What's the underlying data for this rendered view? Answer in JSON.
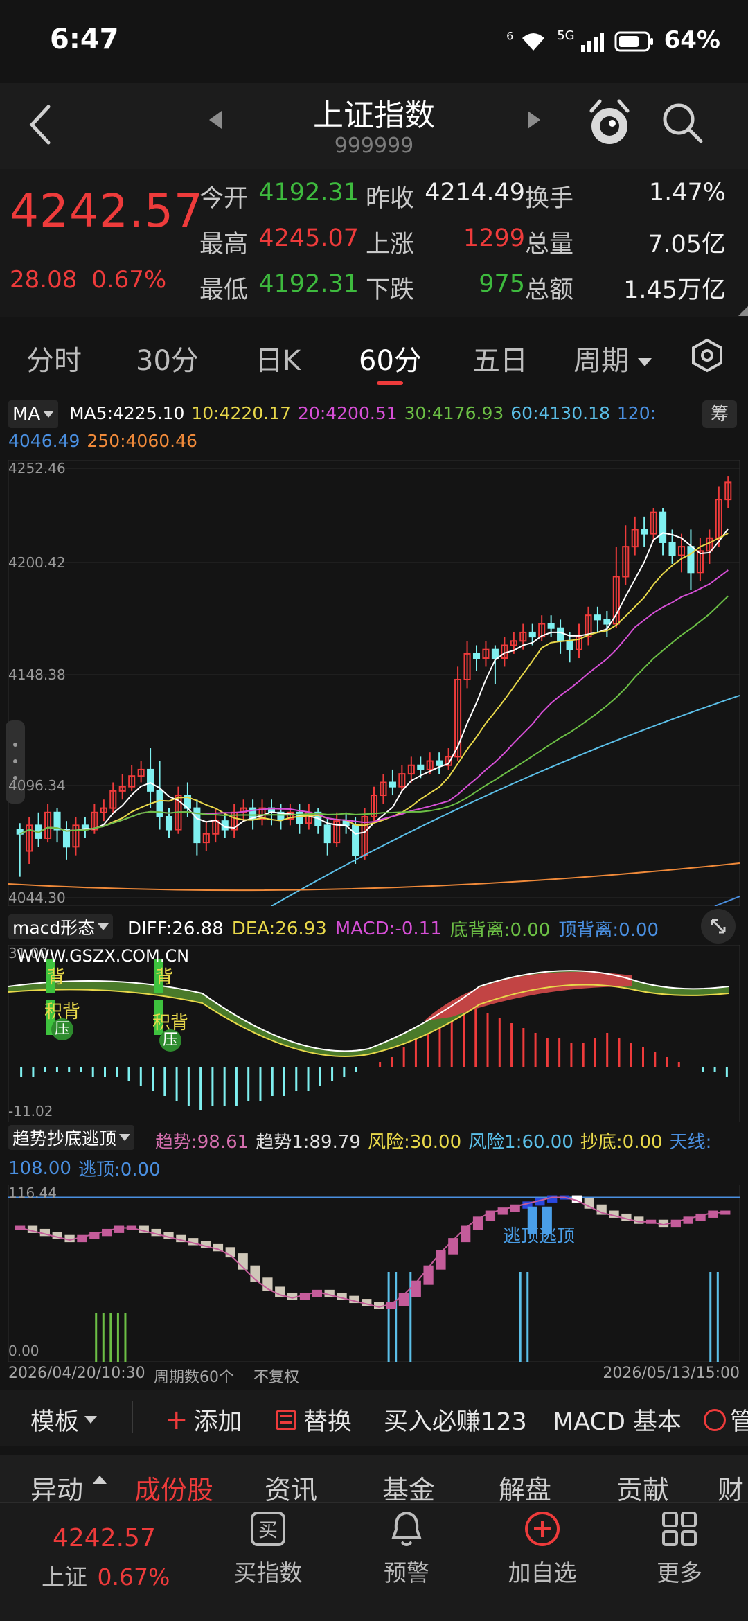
{
  "status": {
    "time": "6:47",
    "net1": "6",
    "net2": "5G",
    "battery": "64%"
  },
  "header": {
    "title": "上证指数",
    "code": "999999"
  },
  "quote": {
    "price": "4242.57",
    "change": "28.08",
    "change_pct": "0.67%",
    "cells": [
      {
        "label": "今开",
        "value": "4192.31",
        "tone": "green"
      },
      {
        "label": "昨收",
        "value": "4214.49",
        "tone": "white"
      },
      {
        "label": "换手",
        "value": "1.47%",
        "tone": "white"
      },
      {
        "label": "最高",
        "value": "4245.07",
        "tone": "red"
      },
      {
        "label": "上涨",
        "value": "1299",
        "tone": "red"
      },
      {
        "label": "总量",
        "value": "7.05亿",
        "tone": "white"
      },
      {
        "label": "最低",
        "value": "4192.31",
        "tone": "green"
      },
      {
        "label": "下跌",
        "value": "975",
        "tone": "green"
      },
      {
        "label": "总额",
        "value": "1.45万亿",
        "tone": "white"
      }
    ]
  },
  "tabs": [
    "分时",
    "30分",
    "日K",
    "60分",
    "五日",
    "周期"
  ],
  "active_tab": "60分",
  "ma": {
    "selector": "MA",
    "line1": [
      {
        "text": "MA5:4225.10",
        "color": "#ffffff"
      },
      {
        "text": "10:4220.17",
        "color": "#e8d84a"
      },
      {
        "text": "20:4200.51",
        "color": "#d64fd6"
      },
      {
        "text": "30:4176.93",
        "color": "#6cbf45"
      },
      {
        "text": "60:4130.18",
        "color": "#5bbfe8"
      },
      {
        "text": "120:",
        "color": "#4a8fe0"
      }
    ],
    "line2": [
      {
        "text": "4046.49",
        "color": "#4a8fe0"
      },
      {
        "text": "250:4060.46",
        "color": "#f08a3a"
      }
    ],
    "chip": "筹"
  },
  "price_axis": [
    "4252.46",
    "4200.42",
    "4148.38",
    "4096.34",
    "4044.30"
  ],
  "macd": {
    "selector": "macd形态",
    "fields": [
      {
        "text": "DIFF:26.88",
        "color": "#ffffff"
      },
      {
        "text": "DEA:26.93",
        "color": "#e8d84a"
      },
      {
        "text": "MACD:-0.11",
        "color": "#d64fd6"
      },
      {
        "text": "底背离:0.00",
        "color": "#6cbf45"
      },
      {
        "text": "顶背离:0.00",
        "color": "#4a8fe0"
      }
    ],
    "axis_top": "31.00",
    "axis_bottom": "-11.02",
    "watermark": "WWW.GSZX.COM.CN",
    "mark_a": "背",
    "mark_b": "积背",
    "mark_c": "压"
  },
  "trend": {
    "selector": "趋势抄底逃顶",
    "fields1": [
      {
        "text": "趋势:98.61",
        "color": "#d46fae"
      },
      {
        "text": "趋势1:89.79",
        "color": "#e0e0e0"
      },
      {
        "text": "风险:30.00",
        "color": "#e8d84a"
      },
      {
        "text": "风险1:60.00",
        "color": "#5bbfe8"
      },
      {
        "text": "抄底:0.00",
        "color": "#e8d84a"
      },
      {
        "text": "天线:",
        "color": "#4a8fe0"
      }
    ],
    "fields2": [
      {
        "text": "108.00",
        "color": "#4a8fe0"
      },
      {
        "text": "逃顶:0.00",
        "color": "#4a8fe0"
      }
    ],
    "axis_top": "116.44",
    "axis_bottom": "0.00",
    "escape_label": "逃顶逃顶"
  },
  "footer_axis": {
    "start": "2026/04/20/10:30",
    "period": "周期数60个",
    "adjust": "不复权",
    "end": "2026/05/13/15:00"
  },
  "toolbar": {
    "template": "模板",
    "add": "添加",
    "replace": "替换",
    "promo": "买入必赚123",
    "macd_basic": "MACD 基本",
    "more": "管"
  },
  "subtabs": [
    "异动",
    "成份股",
    "资讯",
    "基金",
    "解盘",
    "贡献",
    "财"
  ],
  "active_subtab": "成份股",
  "bottom": {
    "price": "4242.57",
    "name": "上证",
    "pct": "0.67%",
    "items": [
      "买指数",
      "预警",
      "加自选",
      "更多"
    ]
  },
  "candles": [
    [
      4080,
      4078,
      4083,
      4058
    ],
    [
      4070,
      4082,
      4086,
      4064
    ],
    [
      4082,
      4076,
      4088,
      4072
    ],
    [
      4076,
      4088,
      4092,
      4074
    ],
    [
      4088,
      4080,
      4090,
      4074
    ],
    [
      4080,
      4072,
      4084,
      4066
    ],
    [
      4072,
      4082,
      4086,
      4068
    ],
    [
      4082,
      4080,
      4086,
      4076
    ],
    [
      4080,
      4088,
      4092,
      4078
    ],
    [
      4088,
      4090,
      4094,
      4084
    ],
    [
      4090,
      4098,
      4102,
      4088
    ],
    [
      4098,
      4100,
      4106,
      4094
    ],
    [
      4100,
      4105,
      4110,
      4098
    ],
    [
      4105,
      4108,
      4112,
      4102
    ],
    [
      4108,
      4098,
      4118,
      4090
    ],
    [
      4098,
      4086,
      4112,
      4080
    ],
    [
      4086,
      4080,
      4090,
      4076
    ],
    [
      4080,
      4096,
      4100,
      4078
    ],
    [
      4096,
      4090,
      4102,
      4086
    ],
    [
      4090,
      4074,
      4094,
      4068
    ],
    [
      4074,
      4078,
      4084,
      4070
    ],
    [
      4078,
      4084,
      4090,
      4074
    ],
    [
      4084,
      4080,
      4088,
      4076
    ],
    [
      4080,
      4088,
      4092,
      4076
    ],
    [
      4088,
      4090,
      4094,
      4084
    ],
    [
      4090,
      4085,
      4094,
      4080
    ],
    [
      4085,
      4090,
      4094,
      4082
    ],
    [
      4090,
      4088,
      4094,
      4082
    ],
    [
      4088,
      4085,
      4092,
      4080
    ],
    [
      4085,
      4088,
      4092,
      4082
    ],
    [
      4088,
      4083,
      4092,
      4078
    ],
    [
      4083,
      4088,
      4092,
      4080
    ],
    [
      4088,
      4082,
      4090,
      4078
    ],
    [
      4082,
      4074,
      4086,
      4068
    ],
    [
      4074,
      4084,
      4088,
      4072
    ],
    [
      4084,
      4082,
      4088,
      4078
    ],
    [
      4082,
      4068,
      4086,
      4064
    ],
    [
      4068,
      4086,
      4090,
      4066
    ],
    [
      4086,
      4096,
      4100,
      4084
    ],
    [
      4096,
      4102,
      4106,
      4092
    ],
    [
      4102,
      4100,
      4108,
      4096
    ],
    [
      4100,
      4106,
      4110,
      4098
    ],
    [
      4106,
      4110,
      4114,
      4102
    ],
    [
      4110,
      4108,
      4114,
      4104
    ],
    [
      4108,
      4112,
      4116,
      4106
    ],
    [
      4112,
      4110,
      4116,
      4106
    ],
    [
      4110,
      4114,
      4118,
      4108
    ],
    [
      4114,
      4150,
      4156,
      4112
    ],
    [
      4150,
      4162,
      4168,
      4146
    ],
    [
      4162,
      4160,
      4166,
      4154
    ],
    [
      4160,
      4164,
      4168,
      4156
    ],
    [
      4164,
      4160,
      4166,
      4148
    ],
    [
      4160,
      4166,
      4170,
      4156
    ],
    [
      4166,
      4168,
      4172,
      4162
    ],
    [
      4168,
      4172,
      4176,
      4164
    ],
    [
      4172,
      4170,
      4176,
      4166
    ],
    [
      4170,
      4176,
      4180,
      4168
    ],
    [
      4176,
      4174,
      4180,
      4170
    ],
    [
      4174,
      4168,
      4178,
      4162
    ],
    [
      4168,
      4164,
      4172,
      4158
    ],
    [
      4164,
      4170,
      4176,
      4160
    ],
    [
      4170,
      4180,
      4184,
      4166
    ],
    [
      4180,
      4178,
      4184,
      4172
    ],
    [
      4178,
      4176,
      4182,
      4170
    ],
    [
      4176,
      4198,
      4212,
      4174
    ],
    [
      4198,
      4212,
      4222,
      4194
    ],
    [
      4212,
      4220,
      4226,
      4208
    ],
    [
      4220,
      4218,
      4226,
      4212
    ],
    [
      4218,
      4228,
      4230,
      4214
    ],
    [
      4228,
      4214,
      4230,
      4208
    ],
    [
      4214,
      4208,
      4220,
      4204
    ],
    [
      4208,
      4212,
      4218,
      4200
    ],
    [
      4212,
      4200,
      4220,
      4192
    ],
    [
      4200,
      4210,
      4216,
      4196
    ],
    [
      4210,
      4216,
      4220,
      4204
    ],
    [
      4216,
      4234,
      4240,
      4212
    ],
    [
      4234,
      4242,
      4245,
      4230
    ]
  ],
  "macd_hist": [
    -2,
    -2,
    -1,
    -1,
    -1,
    -1,
    -2,
    -2,
    -2,
    -3,
    -4,
    -5,
    -6,
    -7,
    -8,
    -9,
    -8,
    -8,
    -8,
    -7,
    -7,
    -6,
    -6,
    -5,
    -5,
    -4,
    -3,
    -2,
    -1,
    0,
    1,
    2,
    4,
    6,
    8,
    10,
    12,
    13,
    12,
    11,
    10,
    9,
    8,
    7,
    6,
    6,
    5,
    5,
    6,
    7,
    6,
    5,
    4,
    3,
    2,
    1,
    0,
    -1,
    -1,
    -2
  ],
  "trend_bars": [
    88,
    86,
    84,
    82,
    80,
    82,
    84,
    86,
    88,
    88,
    86,
    84,
    82,
    80,
    78,
    76,
    74,
    70,
    62,
    54,
    48,
    44,
    42,
    44,
    46,
    44,
    42,
    40,
    38,
    36,
    38,
    44,
    52,
    62,
    72,
    80,
    88,
    94,
    98,
    100,
    102,
    104,
    106,
    108,
    108,
    106,
    102,
    98,
    96,
    94,
    92,
    92,
    90,
    92,
    94,
    96,
    98,
    98
  ],
  "trend_spikes_green": [
    0.12,
    0.13,
    0.14,
    0.15,
    0.16
  ],
  "trend_spikes_cyan": [
    0.52,
    0.53,
    0.55,
    0.7,
    0.71,
    0.96,
    0.97
  ]
}
